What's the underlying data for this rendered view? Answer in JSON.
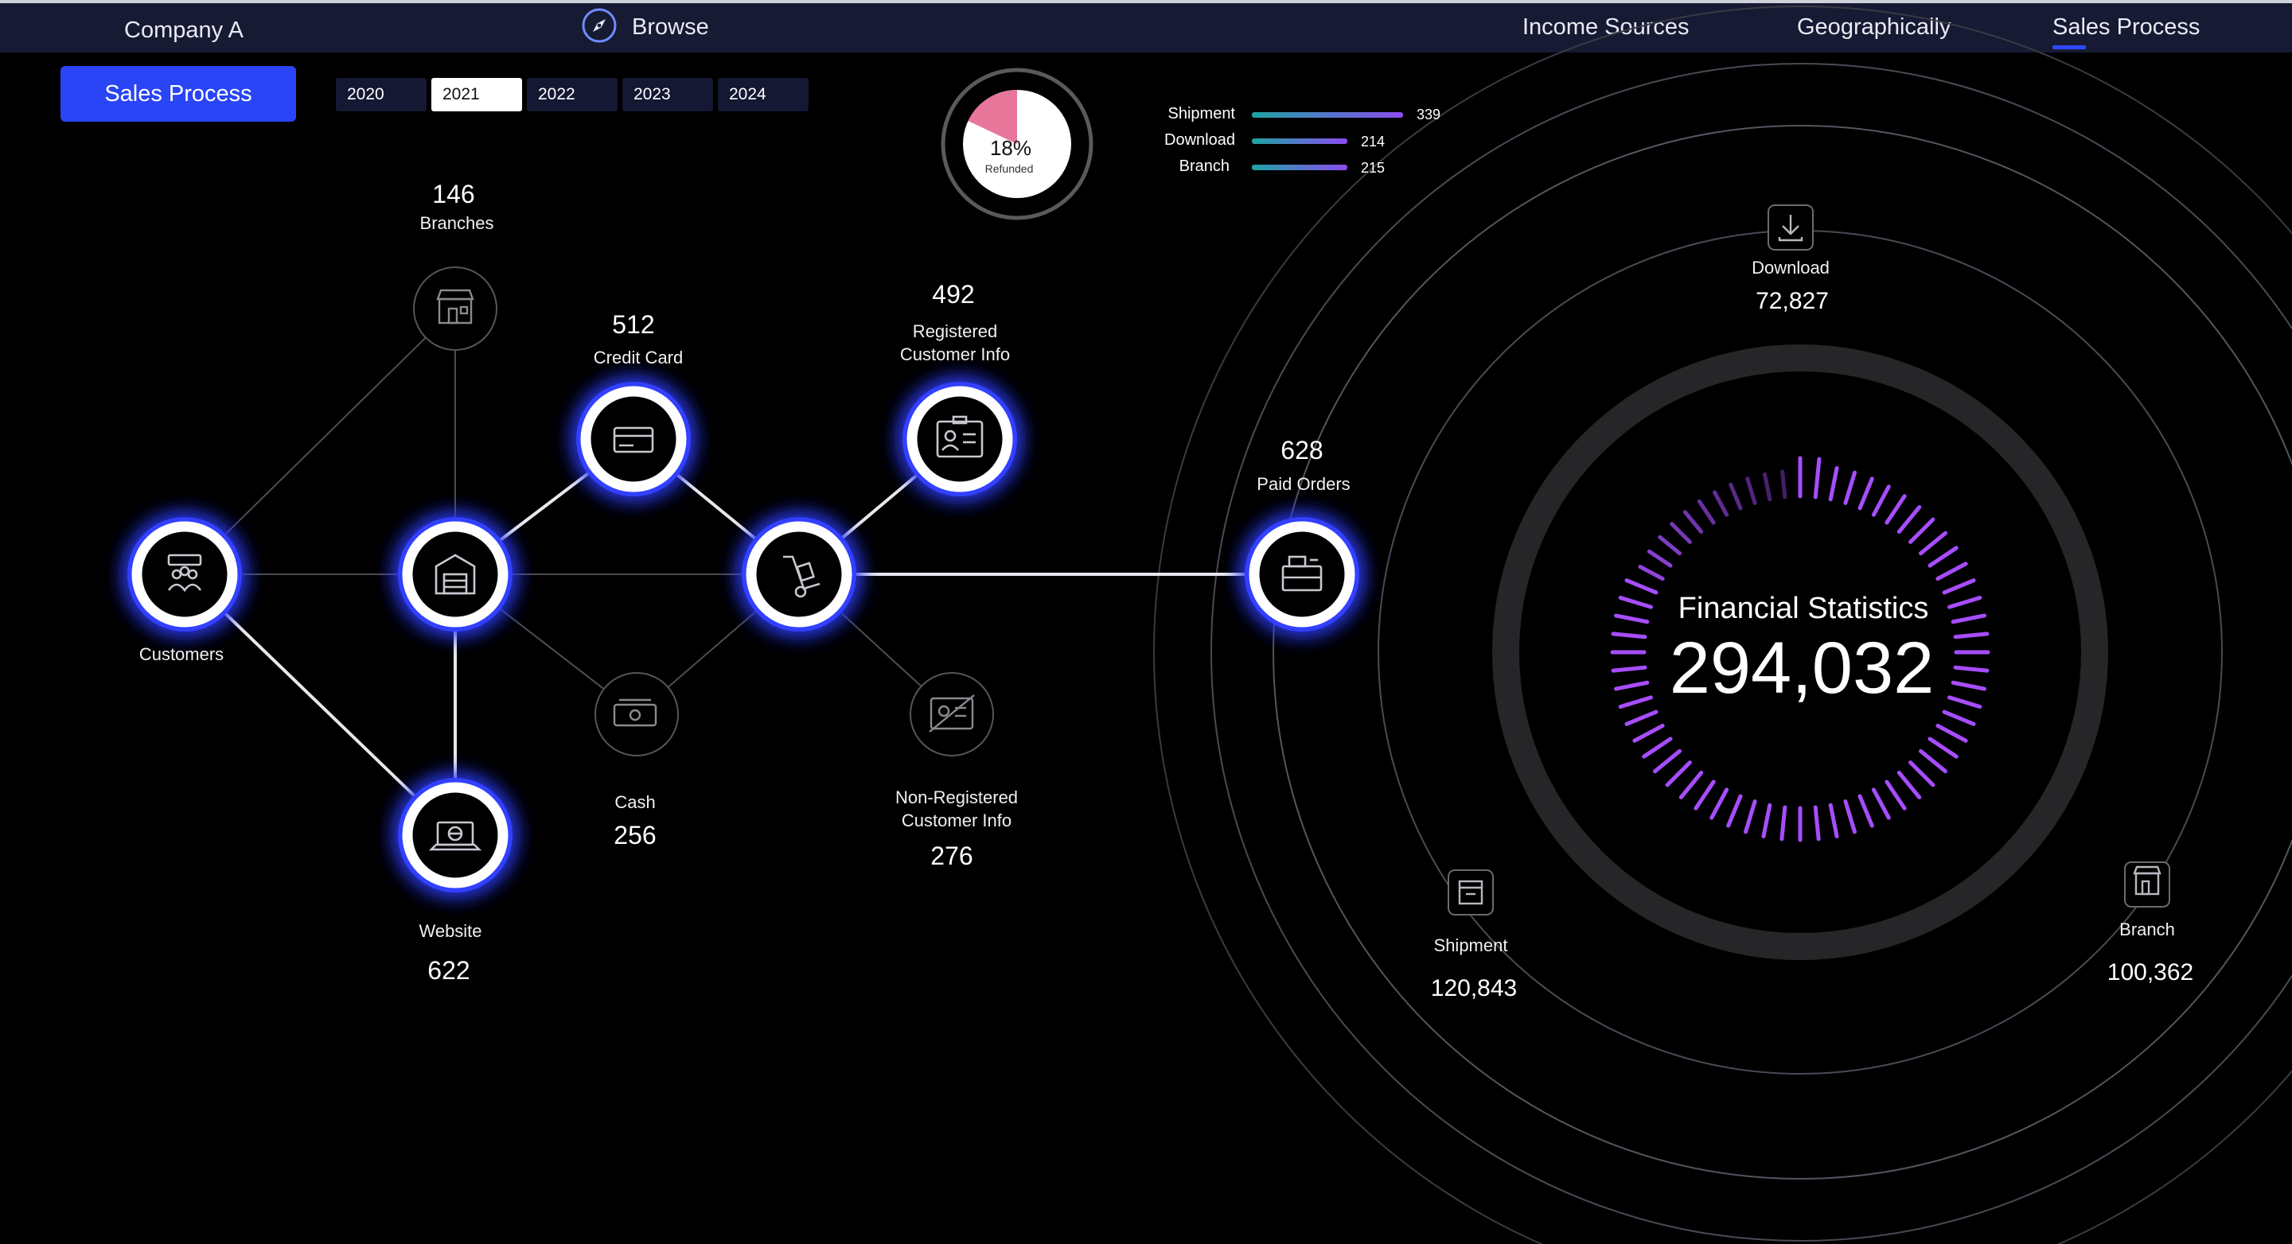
{
  "header": {
    "brand": "Company A",
    "browse_label": "Browse",
    "nav": [
      "Income Sources",
      "Geographically",
      "Sales Process"
    ],
    "active_nav": "Sales Process"
  },
  "sidebar": {
    "sales_process_button": "Sales Process"
  },
  "years": [
    "2020",
    "2021",
    "2022",
    "2023",
    "2024"
  ],
  "active_year": "2021",
  "refund_gauge": {
    "value_text": "18%",
    "label": "Refunded",
    "fraction": 0.18
  },
  "channel_bars": [
    {
      "name": "Shipment",
      "value": "339",
      "fraction": 1.0
    },
    {
      "name": "Download",
      "value": "214",
      "fraction": 0.63
    },
    {
      "name": "Branch",
      "value": "215",
      "fraction": 0.63
    }
  ],
  "nodes": {
    "branches": {
      "value": "146",
      "label": "Branches"
    },
    "credit_card": {
      "value": "512",
      "label": "Credit Card"
    },
    "registered": {
      "value": "492",
      "label1": "Registered",
      "label2": "Customer Info"
    },
    "paid_orders": {
      "value": "628",
      "label": "Paid Orders"
    },
    "customers": {
      "label": "Customers"
    },
    "cash": {
      "value": "256",
      "label": "Cash"
    },
    "non_registered": {
      "value": "276",
      "label1": "Non-Registered",
      "label2": "Customer Info"
    },
    "website": {
      "value": "622",
      "label": "Website"
    }
  },
  "financial": {
    "title": "Financial Statistics",
    "total": "294,032",
    "download": {
      "label": "Download",
      "value": "72,827"
    },
    "shipment": {
      "label": "Shipment",
      "value": "120,843"
    },
    "branch": {
      "label": "Branch",
      "value": "100,362"
    }
  },
  "colors": {
    "accent": "#2a45f6",
    "topbar": "#171a33",
    "glow": "#3340ff",
    "gauge_pink": "#e8769a",
    "bar_start": "#1fa3a3",
    "bar_end": "#8a4cf0",
    "tick_purple": "#a74dff"
  }
}
